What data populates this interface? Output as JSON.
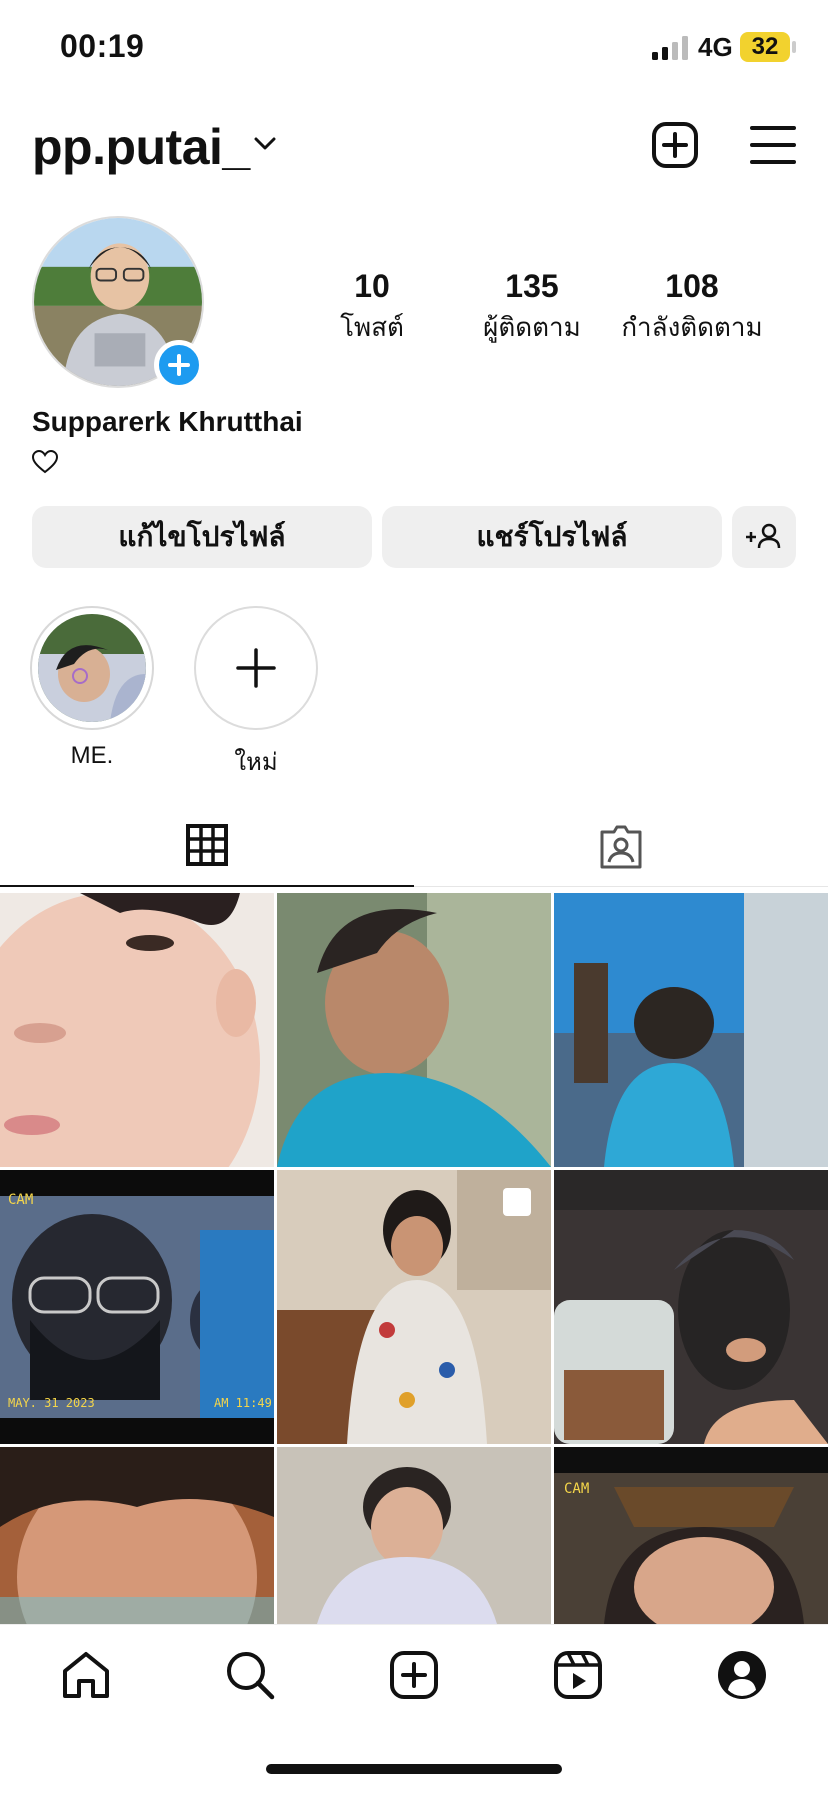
{
  "status_bar": {
    "time": "00:19",
    "network": "4G",
    "battery": "32",
    "battery_color": "#f2d22e"
  },
  "header": {
    "username": "pp.putai_",
    "icons": [
      "chevron-down-icon",
      "new-post-icon",
      "menu-icon"
    ]
  },
  "profile": {
    "stats": [
      {
        "value": "10",
        "label": "โพสต์"
      },
      {
        "value": "135",
        "label": "ผู้ติดตาม"
      },
      {
        "value": "108",
        "label": "กำลังติดตาม"
      }
    ],
    "full_name": "Supparerk Khrutthai",
    "bio_icon": "heart-icon",
    "accent_color": "#1d9bf0"
  },
  "actions": {
    "edit_profile": "แก้ไขโปรไฟล์",
    "share_profile": "แชร์โปรไฟล์",
    "discover_people_icon": "add-person-icon"
  },
  "highlights": [
    {
      "label": "ME."
    },
    {
      "label": "ใหม่"
    }
  ],
  "tabs": [
    {
      "icon": "grid-icon",
      "active": true
    },
    {
      "icon": "tagged-icon",
      "active": false
    }
  ],
  "grid": {
    "rows": 3,
    "columns": 3,
    "photo_count_visible": 9,
    "captions": [
      "CAM",
      "MAY. 31 2023",
      "AM 11:49",
      "CAM"
    ]
  },
  "bottom_nav": [
    "home-icon",
    "search-icon",
    "create-icon",
    "reels-icon",
    "profile-icon"
  ]
}
